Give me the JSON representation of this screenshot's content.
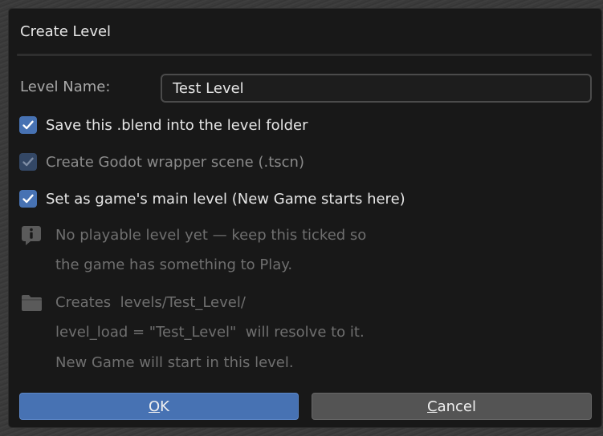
{
  "dialog": {
    "title": "Create Level",
    "level_name_label": "Level Name:",
    "level_name_value": "Test Level",
    "checkboxes": [
      {
        "label": "Save this .blend into the level folder",
        "checked": true,
        "enabled": true
      },
      {
        "label": "Create Godot wrapper scene (.tscn)",
        "checked": true,
        "enabled": false
      },
      {
        "label": "Set as game's main level (New Game starts here)",
        "checked": true,
        "enabled": true
      }
    ],
    "info_note": {
      "icon": "info-icon",
      "lines": [
        "No playable level yet — keep this ticked so",
        "the game has something to Play."
      ]
    },
    "folder_note": {
      "icon": "folder-icon",
      "lines": [
        "Creates  levels/Test_Level/",
        "level_load = \"Test_Level\"  will resolve to it.",
        "New Game will start in this level."
      ]
    },
    "ok_button": {
      "underlined": "O",
      "rest": "K"
    },
    "cancel_button": {
      "underlined": "C",
      "rest": "ancel"
    }
  },
  "colors": {
    "accent": "#4772b3",
    "dialog_bg": "#181818",
    "button_bg": "#545454"
  }
}
